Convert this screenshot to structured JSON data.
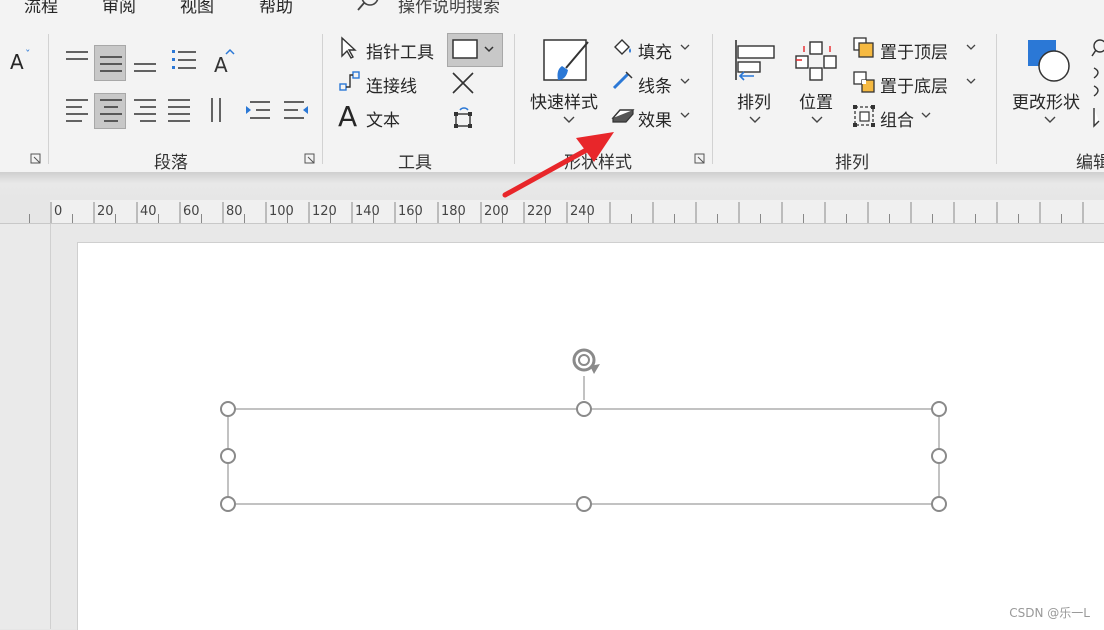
{
  "tabs": [
    "流程",
    "审阅",
    "视图",
    "帮助"
  ],
  "search": {
    "label": "操作说明搜索",
    "icon": "search-icon"
  },
  "groups": {
    "paragraph": {
      "label": "段落"
    },
    "tools": {
      "label": "工具",
      "pointer": "指针工具",
      "connector": "连接线",
      "text": "文本"
    },
    "shape_styles": {
      "label": "形状样式",
      "quick_styles": "快速样式",
      "fill": "填充",
      "line": "线条",
      "effects": "效果"
    },
    "arrange": {
      "label": "排列",
      "align": "排列",
      "position": "位置",
      "bring_front": "置于顶层",
      "send_back": "置于底层",
      "group": "组合"
    },
    "edit": {
      "label": "编辑",
      "change_shape": "更改形状"
    }
  },
  "ruler": {
    "ticks": [
      "0",
      "20",
      "40",
      "60",
      "80",
      "100",
      "120",
      "140",
      "160",
      "180",
      "200",
      "220",
      "240"
    ]
  },
  "watermark": "CSDN @乐一L",
  "colors": {
    "accent": "#2b78d6",
    "arrow": "#e8262a",
    "selection": "#c8c8c8"
  }
}
